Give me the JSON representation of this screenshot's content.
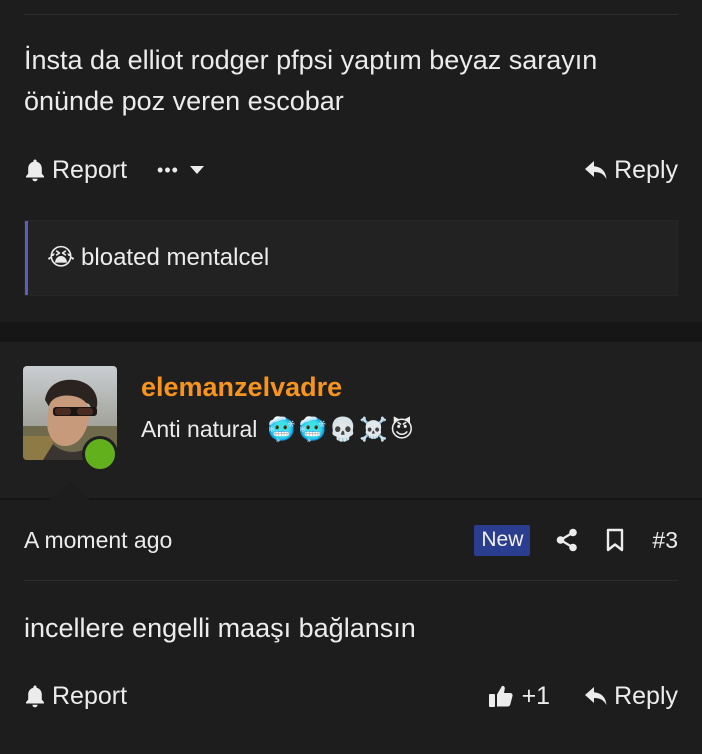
{
  "post1": {
    "body": "İnsta da elliot rodger pfpsi yaptım beyaz sarayın önünde poz veren escobar",
    "report_label": "Report",
    "more_label": "•••",
    "reply_label": "Reply",
    "reaction": {
      "emoji": "😭",
      "text": "bloated mentalcel"
    }
  },
  "post2": {
    "username": "elemanzelvadre",
    "user_title": "Anti natural",
    "title_emojis": [
      "🥶",
      "🥶",
      "💀",
      "☠️",
      "😈"
    ],
    "timestamp": "A moment ago",
    "new_badge": "New",
    "post_number": "#3",
    "body": "incellere engelli maaşı bağlansın",
    "report_label": "Report",
    "like_count": "+1",
    "reply_label": "Reply"
  },
  "colors": {
    "username": "#f7941d",
    "new_badge": "#2a3d8f",
    "online": "#63b01d",
    "quote_accent": "#5a5fbf"
  }
}
